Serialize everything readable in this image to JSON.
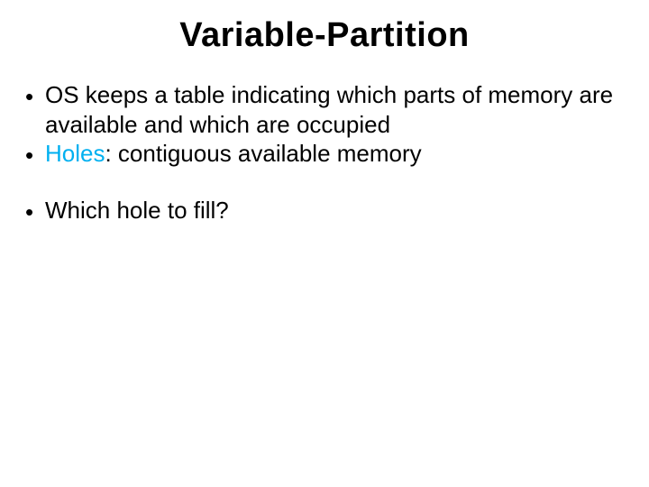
{
  "title": "Variable-Partition",
  "bullets": {
    "b1": "OS keeps a table indicating which parts of memory are available and which are occupied",
    "b2_term": "Holes",
    "b2_rest": ": contiguous available memory",
    "b3": "Which hole to fill?"
  },
  "glyphs": {
    "bullet_dot": "•"
  }
}
